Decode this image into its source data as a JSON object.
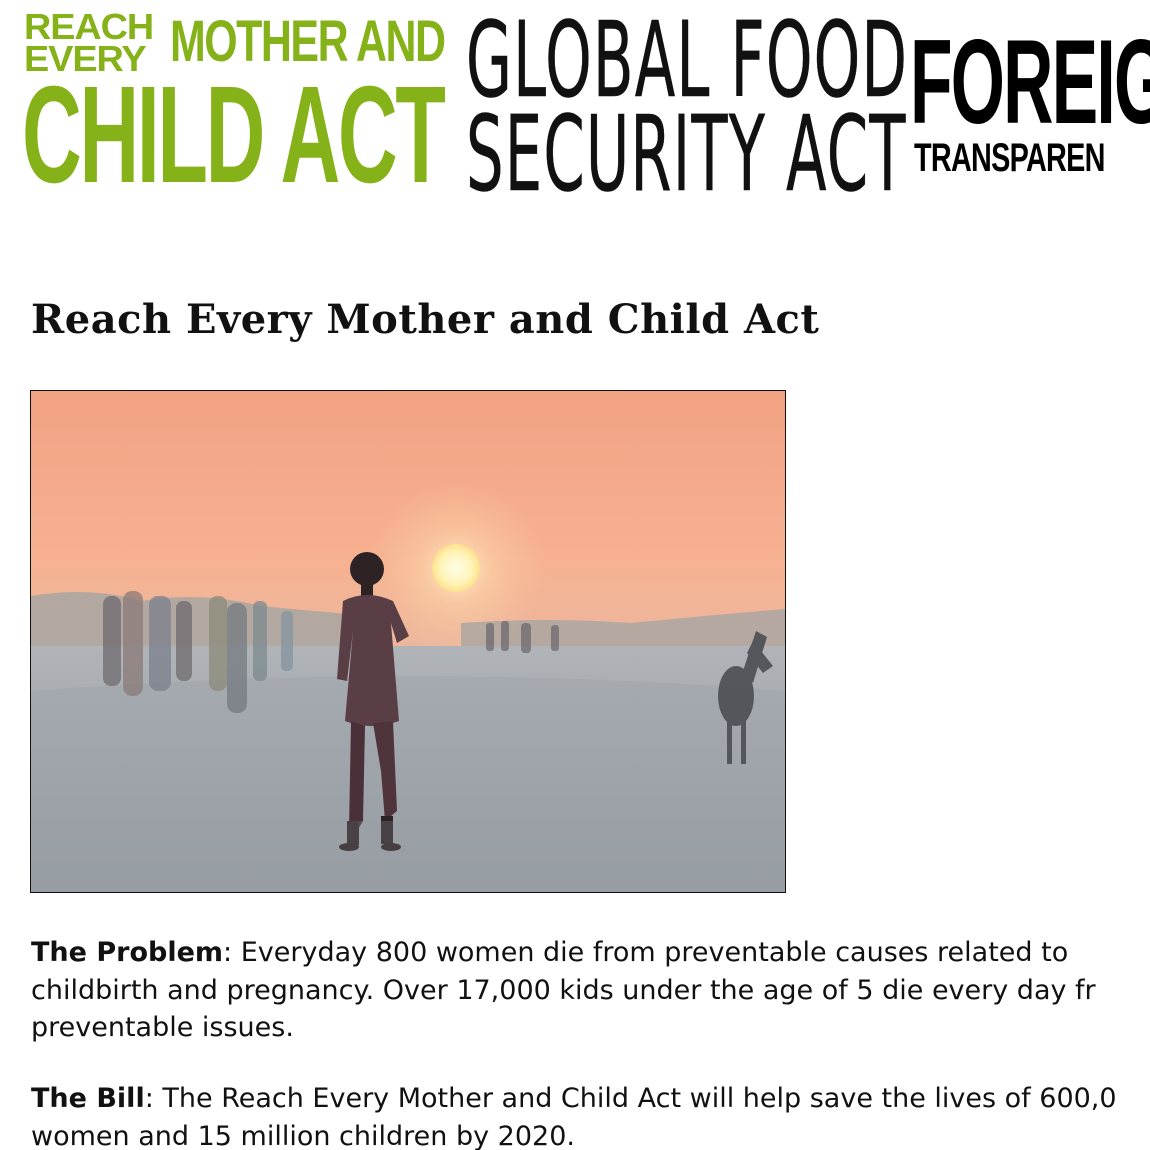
{
  "logos": {
    "remca": {
      "reach": "REACH",
      "every": "EVERY",
      "mother_and": "MOTHER AND",
      "child_act": "CHILD ACT",
      "color": "#86b219"
    },
    "gfsa": {
      "line1": "GLOBAL FOOD",
      "line2": "SECURITY ACT"
    },
    "fat": {
      "line1": "FOREIGN A",
      "line2": "TRANSPAREN"
    }
  },
  "page": {
    "title": "Reach Every Mother and Child Act"
  },
  "photo": {
    "subject": "child walking on dusty road at sunset, with people and a donkey in the background"
  },
  "problem": {
    "label": "The Problem",
    "line1": "Everyday 800 women die from preventable causes related to",
    "line2": "childbirth and pregnancy. Over 17,000 kids under the age of 5 die every day fr",
    "line3": "preventable issues."
  },
  "bill": {
    "label": "The Bill",
    "line1": "The Reach Every Mother and Child Act will help save the lives of 600,0",
    "line2": "women and 15 million children by 2020."
  }
}
